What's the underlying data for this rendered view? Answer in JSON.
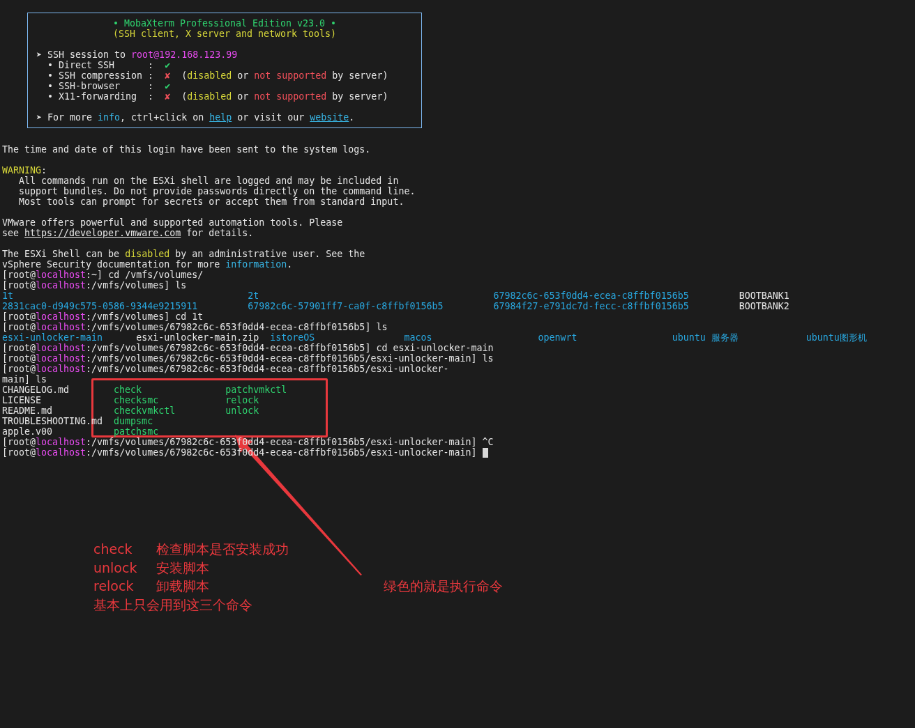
{
  "banner": {
    "lines": [
      {
        "kind": "center",
        "segments": [
          {
            "text": "• MobaXterm Professional Edition v23.0 •",
            "kind": "green"
          }
        ]
      },
      {
        "kind": "center",
        "segments": [
          {
            "text": "(SSH client, X server and network tools)",
            "kind": "yellow"
          }
        ]
      },
      {
        "kind": "blank"
      },
      {
        "kind": "line",
        "segments": [
          {
            "text": "➤ SSH session to ",
            "kind": "plain"
          },
          {
            "text": "root@192.168.123.99",
            "kind": "magenta"
          }
        ]
      },
      {
        "kind": "line",
        "segments": [
          {
            "text": "  • Direct SSH      :  ",
            "kind": "plain"
          },
          {
            "text": "✔",
            "kind": "green"
          }
        ]
      },
      {
        "kind": "line",
        "segments": [
          {
            "text": "  • SSH compression :  ",
            "kind": "plain"
          },
          {
            "text": "✘",
            "kind": "red"
          },
          {
            "text": "  (",
            "kind": "plain"
          },
          {
            "text": "disabled",
            "kind": "yellow"
          },
          {
            "text": " or ",
            "kind": "plain"
          },
          {
            "text": "not supported",
            "kind": "red"
          },
          {
            "text": " by server)",
            "kind": "plain"
          }
        ]
      },
      {
        "kind": "line",
        "segments": [
          {
            "text": "  • SSH-browser     :  ",
            "kind": "plain"
          },
          {
            "text": "✔",
            "kind": "green"
          }
        ]
      },
      {
        "kind": "line",
        "segments": [
          {
            "text": "  • X11-forwarding  :  ",
            "kind": "plain"
          },
          {
            "text": "✘",
            "kind": "red"
          },
          {
            "text": "  (",
            "kind": "plain"
          },
          {
            "text": "disabled",
            "kind": "yellow"
          },
          {
            "text": " or ",
            "kind": "plain"
          },
          {
            "text": "not supported",
            "kind": "red"
          },
          {
            "text": " by server)",
            "kind": "plain"
          }
        ]
      },
      {
        "kind": "blank"
      },
      {
        "kind": "line",
        "segments": [
          {
            "text": "➤ For more ",
            "kind": "plain"
          },
          {
            "text": "info",
            "kind": "cyan"
          },
          {
            "text": ", ctrl+click on ",
            "kind": "plain"
          },
          {
            "text": "help",
            "kind": "link"
          },
          {
            "text": " or visit our ",
            "kind": "plain"
          },
          {
            "text": "website",
            "kind": "link"
          },
          {
            "text": ".",
            "kind": "plain"
          }
        ]
      }
    ]
  },
  "terminal": {
    "lines": [
      {
        "kind": "blank"
      },
      {
        "kind": "line",
        "segments": [
          {
            "text": "The time and date of this login have been sent to the system logs.",
            "kind": "plain"
          }
        ]
      },
      {
        "kind": "blank"
      },
      {
        "kind": "line",
        "segments": [
          {
            "text": "WARNING",
            "kind": "yellow"
          },
          {
            "text": ":",
            "kind": "plain"
          }
        ]
      },
      {
        "kind": "line",
        "segments": [
          {
            "text": "   All commands run on the ESXi shell are logged and may be included in",
            "kind": "plain"
          }
        ]
      },
      {
        "kind": "line",
        "segments": [
          {
            "text": "   support bundles. Do not provide passwords directly on the command line.",
            "kind": "plain"
          }
        ]
      },
      {
        "kind": "line",
        "segments": [
          {
            "text": "   Most tools can prompt for secrets or accept them from standard input.",
            "kind": "plain"
          }
        ]
      },
      {
        "kind": "blank"
      },
      {
        "kind": "line",
        "segments": [
          {
            "text": "VMware offers powerful and supported automation tools. Please",
            "kind": "plain"
          }
        ]
      },
      {
        "kind": "line",
        "segments": [
          {
            "text": "see ",
            "kind": "plain"
          },
          {
            "text": "https://developer.vmware.com",
            "kind": "link-plain"
          },
          {
            "text": " for details.",
            "kind": "plain"
          }
        ]
      },
      {
        "kind": "blank"
      },
      {
        "kind": "line",
        "segments": [
          {
            "text": "The ESXi Shell can be ",
            "kind": "plain"
          },
          {
            "text": "disabled",
            "kind": "yellow"
          },
          {
            "text": " by an administrative user. See the",
            "kind": "plain"
          }
        ]
      },
      {
        "kind": "line",
        "segments": [
          {
            "text": "vSphere Security documentation for more ",
            "kind": "plain"
          },
          {
            "text": "information",
            "kind": "cyan"
          },
          {
            "text": ".",
            "kind": "plain"
          }
        ]
      },
      {
        "kind": "line",
        "segments": [
          {
            "text": "[root@",
            "kind": "plain"
          },
          {
            "text": "localhost",
            "kind": "magenta"
          },
          {
            "text": ":~] cd /vmfs/volumes/",
            "kind": "plain"
          }
        ]
      },
      {
        "kind": "line",
        "segments": [
          {
            "text": "[root@",
            "kind": "plain"
          },
          {
            "text": "localhost",
            "kind": "magenta"
          },
          {
            "text": ":/vmfs/volumes] ls",
            "kind": "plain"
          }
        ]
      },
      {
        "kind": "listing-wide",
        "rows": [
          [
            {
              "text": "1t",
              "kind": "dir"
            },
            {
              "text": "2t",
              "kind": "dir"
            },
            {
              "text": "67982c6c-653f0dd4-ecea-c8ffbf0156b5",
              "kind": "dir"
            },
            {
              "text": "BOOTBANK1",
              "kind": "file"
            }
          ],
          [
            {
              "text": "2831cac0-d949c575-0586-9344e9215911",
              "kind": "dir"
            },
            {
              "text": "67982c6c-57901ff7-ca0f-c8ffbf0156b5",
              "kind": "dir"
            },
            {
              "text": "67984f27-e791dc7d-fecc-c8ffbf0156b5",
              "kind": "dir"
            },
            {
              "text": "BOOTBANK2",
              "kind": "file"
            }
          ]
        ]
      },
      {
        "kind": "line",
        "segments": [
          {
            "text": "[root@",
            "kind": "plain"
          },
          {
            "text": "localhost",
            "kind": "magenta"
          },
          {
            "text": ":/vmfs/volumes] cd 1t",
            "kind": "plain"
          }
        ]
      },
      {
        "kind": "line",
        "segments": [
          {
            "text": "[root@",
            "kind": "plain"
          },
          {
            "text": "localhost",
            "kind": "magenta"
          },
          {
            "text": ":/vmfs/volumes/67982c6c-653f0dd4-ecea-c8ffbf0156b5] ls",
            "kind": "plain"
          }
        ]
      },
      {
        "kind": "listing-medium",
        "rows": [
          [
            {
              "text": "esxi-unlocker-main",
              "kind": "dir"
            },
            {
              "text": "esxi-unlocker-main.zip",
              "kind": "file"
            },
            {
              "text": "istoreOS",
              "kind": "dir"
            },
            {
              "text": "macos",
              "kind": "dir"
            },
            {
              "text": "openwrt",
              "kind": "dir"
            },
            {
              "text": "ubuntu 服务器",
              "kind": "dir"
            },
            {
              "text": "ubuntu图形机",
              "kind": "dir"
            }
          ]
        ]
      },
      {
        "kind": "line",
        "segments": [
          {
            "text": "[root@",
            "kind": "plain"
          },
          {
            "text": "localhost",
            "kind": "magenta"
          },
          {
            "text": ":/vmfs/volumes/67982c6c-653f0dd4-ecea-c8ffbf0156b5] cd esxi-unlocker-main",
            "kind": "plain"
          }
        ]
      },
      {
        "kind": "line",
        "segments": [
          {
            "text": "[root@",
            "kind": "plain"
          },
          {
            "text": "localhost",
            "kind": "magenta"
          },
          {
            "text": ":/vmfs/volumes/67982c6c-653f0dd4-ecea-c8ffbf0156b5/esxi-unlocker-main] ls",
            "kind": "plain"
          }
        ]
      },
      {
        "kind": "line",
        "segments": [
          {
            "text": "[root@",
            "kind": "plain"
          },
          {
            "text": "localhost",
            "kind": "magenta"
          },
          {
            "text": ":/vmfs/volumes/67982c6c-653f0dd4-ecea-c8ffbf0156b5/esxi-unlocker-",
            "kind": "plain"
          }
        ]
      },
      {
        "kind": "line",
        "segments": [
          {
            "text": "main] ls",
            "kind": "plain"
          }
        ]
      },
      {
        "kind": "listing-narrow",
        "rows": [
          [
            {
              "text": "CHANGELOG.md",
              "kind": "file"
            },
            {
              "text": "check",
              "kind": "exec"
            },
            {
              "text": "patchvmkctl",
              "kind": "exec"
            }
          ],
          [
            {
              "text": "LICENSE",
              "kind": "file"
            },
            {
              "text": "checksmc",
              "kind": "exec"
            },
            {
              "text": "relock",
              "kind": "exec"
            }
          ],
          [
            {
              "text": "README.md",
              "kind": "file"
            },
            {
              "text": "checkvmkctl",
              "kind": "exec"
            },
            {
              "text": "unlock",
              "kind": "exec"
            }
          ],
          [
            {
              "text": "TROUBLESHOOTING.md",
              "kind": "file"
            },
            {
              "text": "dumpsmc",
              "kind": "exec"
            }
          ],
          [
            {
              "text": "apple.v00",
              "kind": "file"
            },
            {
              "text": "patchsmc",
              "kind": "exec"
            }
          ]
        ]
      },
      {
        "kind": "line",
        "segments": [
          {
            "text": "[root@",
            "kind": "plain"
          },
          {
            "text": "localhost",
            "kind": "magenta"
          },
          {
            "text": ":/vmfs/volumes/67982c6c-653f0dd4-ecea-c8ffbf0156b5/esxi-unlocker-main] ^C",
            "kind": "plain"
          }
        ]
      },
      {
        "kind": "line",
        "cursor": true,
        "segments": [
          {
            "text": "[root@",
            "kind": "plain"
          },
          {
            "text": "localhost",
            "kind": "magenta"
          },
          {
            "text": ":/vmfs/volumes/67982c6c-653f0dd4-ecea-c8ffbf0156b5/esxi-unlocker-main] ",
            "kind": "plain"
          }
        ]
      }
    ]
  },
  "notes": {
    "rows": [
      {
        "command": "check",
        "description": "检查脚本是否安装成功"
      },
      {
        "command": "unlock",
        "description": "安装脚本"
      },
      {
        "command": "relock",
        "description": "卸载脚本"
      }
    ],
    "summary": "基本上只会用到这三个命令",
    "arrow_note": "绿色的就是执行命令"
  }
}
